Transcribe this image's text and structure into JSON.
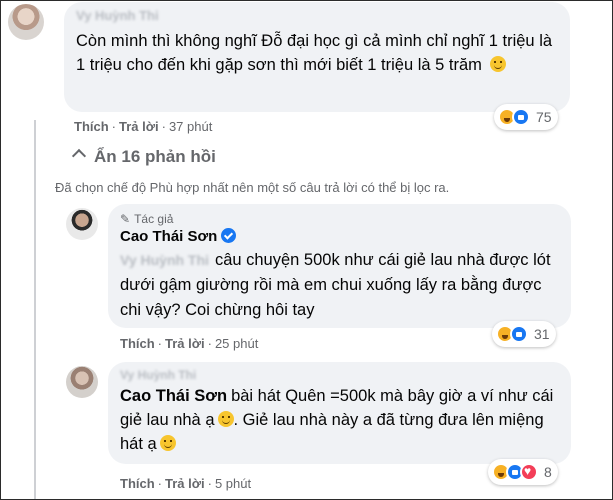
{
  "comment1": {
    "author": "Vy Huỳnh Thi",
    "text": "Còn mình thì không nghĩ Đỗ đại học gì cả mình chỉ nghĩ 1 triệu là 1 triệu cho đến khi gặp sơn thì mới biết 1 triệu là 5 trăm",
    "like_label": "Thích",
    "reply_label": "Trả lời",
    "time": "37 phút",
    "reaction_count": "75",
    "reaction_icons": [
      "haha-icon",
      "like-icon"
    ]
  },
  "replies_toggle": {
    "label": "Ẩn 16 phản hồi"
  },
  "filter_note": "Đã chọn chế độ Phù hợp nhất nên một số câu trả lời có thể bị lọc ra.",
  "reply1": {
    "author_badge": "Tác giả",
    "author": "Cao Thái Sơn",
    "mention": "Vy Huỳnh Thi",
    "text": "câu chuyện 500k như cái giẻ lau nhà được lót dưới gậm giường rồi mà em chui xuống lấy ra bằng được chi vậy? Coi chừng hôi tay",
    "like_label": "Thích",
    "reply_label": "Trả lời",
    "time": "25 phút",
    "reaction_count": "31"
  },
  "reply2": {
    "author": "Vy Huỳnh Thi",
    "mention": "Cao Thái Sơn",
    "text_part1": "bài hát Quên =500k mà bây giờ a ví như cái giẻ lau nhà ạ",
    "text_part2": ". Giẻ lau nhà này a đã từng đưa lên miệng hát ạ",
    "like_label": "Thích",
    "reply_label": "Trả lời",
    "time": "5 phút",
    "reaction_count": "8"
  },
  "colors": {
    "accent": "#1877f2",
    "bubble": "#f0f2f5",
    "meta": "#65676b"
  }
}
